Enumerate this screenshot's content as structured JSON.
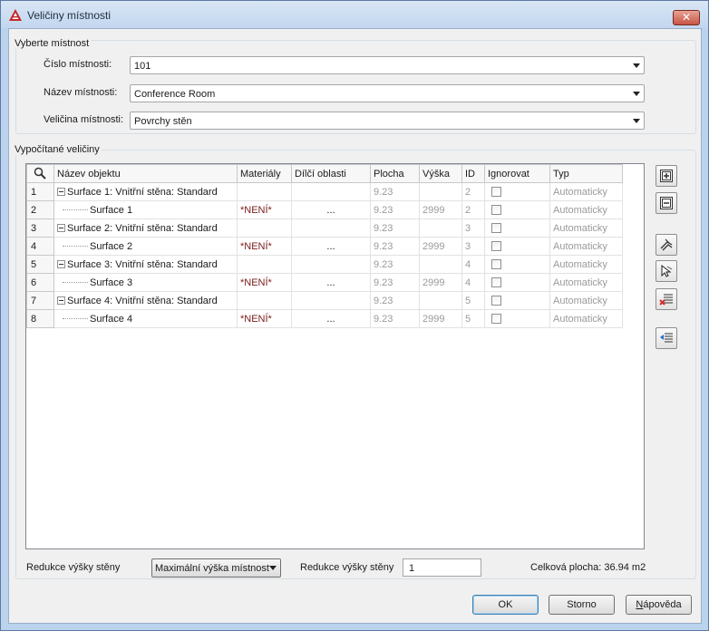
{
  "window": {
    "title": "Veličiny místnosti",
    "close": "✕"
  },
  "select_room": {
    "group_title": "Vyberte místnost",
    "room_number_label": "Číslo místnosti:",
    "room_number_value": "101",
    "room_name_label": "Název místnosti:",
    "room_name_value": "Conference Room",
    "quantity_label": "Veličina místnosti:",
    "quantity_value": "Povrchy stěn"
  },
  "computed": {
    "group_title": "Vypočítané veličiny",
    "columns": [
      "Název objektu",
      "Materiály",
      "Dílčí oblasti",
      "Plocha",
      "Výška",
      "ID",
      "Ignorovat",
      "Typ"
    ],
    "rows": [
      {
        "n": "1",
        "name": "Surface 1: Vnitřní stěna: Standard",
        "parent": true,
        "material": "",
        "sub": "",
        "area": "9.23",
        "height": "",
        "id": "2",
        "type": "Automaticky"
      },
      {
        "n": "2",
        "name": "Surface 1",
        "parent": false,
        "material": "*NENÍ*",
        "sub": "...",
        "area": "9.23",
        "height": "2999",
        "id": "2",
        "type": "Automaticky"
      },
      {
        "n": "3",
        "name": "Surface 2: Vnitřní stěna: Standard",
        "parent": true,
        "material": "",
        "sub": "",
        "area": "9.23",
        "height": "",
        "id": "3",
        "type": "Automaticky"
      },
      {
        "n": "4",
        "name": "Surface 2",
        "parent": false,
        "material": "*NENÍ*",
        "sub": "...",
        "area": "9.23",
        "height": "2999",
        "id": "3",
        "type": "Automaticky"
      },
      {
        "n": "5",
        "name": "Surface 3: Vnitřní stěna: Standard",
        "parent": true,
        "material": "",
        "sub": "",
        "area": "9.23",
        "height": "",
        "id": "4",
        "type": "Automaticky"
      },
      {
        "n": "6",
        "name": "Surface 3",
        "parent": false,
        "material": "*NENÍ*",
        "sub": "...",
        "area": "9.23",
        "height": "2999",
        "id": "4",
        "type": "Automaticky"
      },
      {
        "n": "7",
        "name": "Surface 4: Vnitřní stěna: Standard",
        "parent": true,
        "material": "",
        "sub": "",
        "area": "9.23",
        "height": "",
        "id": "5",
        "type": "Automaticky"
      },
      {
        "n": "8",
        "name": "Surface 4",
        "parent": false,
        "material": "*NENÍ*",
        "sub": "...",
        "area": "9.23",
        "height": "2999",
        "id": "5",
        "type": "Automaticky"
      }
    ]
  },
  "bottom": {
    "wall_height_reduction_label": "Redukce výšky stěny",
    "wall_height_reduction_select": "Maximální výška místnost",
    "wall_height_reduction_label2": "Redukce výšky stěny",
    "wall_height_reduction_value": "1",
    "total_area": "Celková plocha: 36.94 m2"
  },
  "buttons": {
    "ok": "OK",
    "cancel": "Storno",
    "help": "Nápověda"
  },
  "icons": {
    "app": "autocad-logo-icon",
    "search": "magnifier-icon",
    "expand": "expand-all-icon",
    "collapse": "collapse-all-icon",
    "select_wall": "select-wall-icon",
    "select_object": "select-object-icon",
    "remove": "remove-surface-icon",
    "add": "add-surface-icon"
  },
  "colors": {
    "title_bar": "#c2d6ee",
    "dialog_bg": "#f0f0f0",
    "accent_red": "#c62828"
  }
}
